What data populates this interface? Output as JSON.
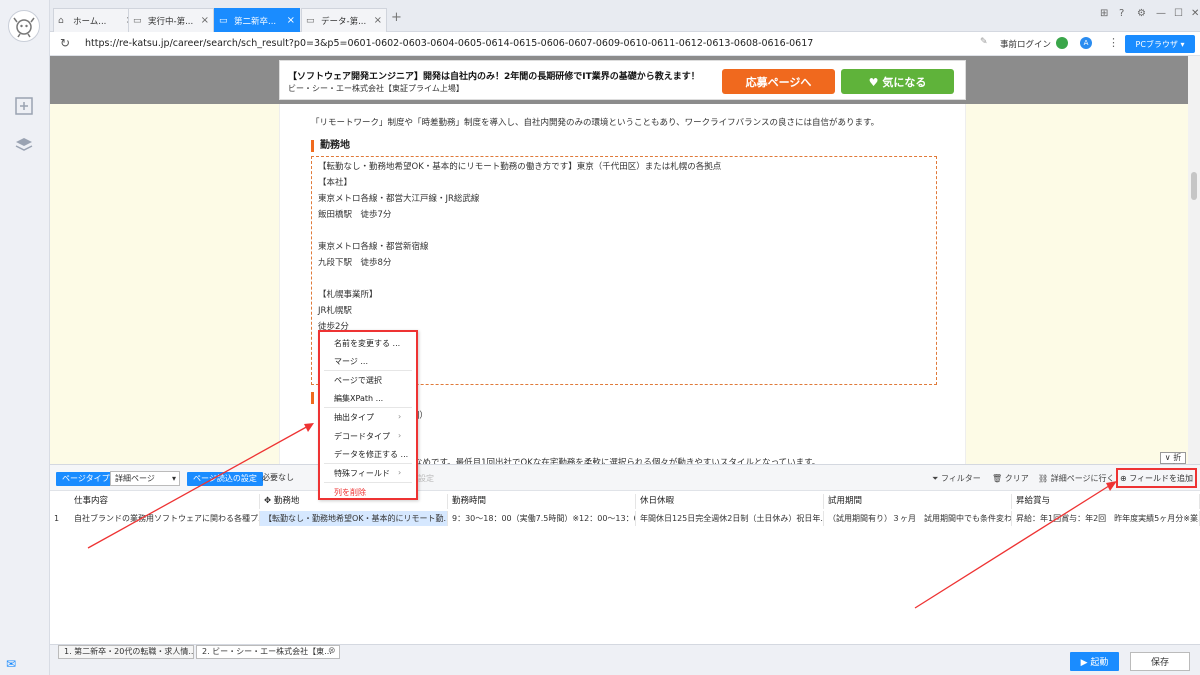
{
  "tabs": [
    {
      "label": "ホーム...",
      "icon": "home-icon"
    },
    {
      "label": "実行中-第...",
      "icon": "page-icon"
    },
    {
      "label": "第二新卒...",
      "icon": "page-icon"
    },
    {
      "label": "データ-第...",
      "icon": "page-icon"
    }
  ],
  "address": {
    "url": "https://re-katsu.jp/career/search/sch_result?p0=3&p5=0601-0602-0603-0604-0605-0614-0615-0606-0607-0609-0610-0611-0612-0613-0608-0616-0617",
    "prelogin": "事前ログイン",
    "browser_button": "PCブラウザ"
  },
  "job": {
    "title": "【ソフトウェア開発エンジニア】開発は自社内のみ！2年間の長期研修でIT業界の基礎から教えます！",
    "company": "ビー・シー・エー株式会社【東証プライム上場】",
    "apply_label": "応募ページへ",
    "fav_label": "♥ 気になる",
    "intro": "「リモートワーク」制度や「時差勤務」制度を導入し、自社内開発のみの環境ということもあり、ワークライフバランスの良さには自信があります。",
    "section_title": "勤務地",
    "location_lines": [
      "【転勤なし・勤務地希望OK・基本的にリモート勤務の働き方です】東京（千代田区）または札幌の各拠点",
      "【本社】",
      "東京メトロ各線・都営大江戸線・JR総武線",
      "飯田橋駅　徒歩7分",
      "",
      "東京メトロ各線・都営新宿線",
      "九段下駅　徒歩8分",
      "",
      "【札幌事業所】",
      "JR札幌駅",
      "徒歩2分"
    ],
    "partial_1": "5時間）",
    "partial_2": "休憩",
    "partial_3": "と少なめです。最低月1回出社でOKな在宅勤務を柔軟に選択られる個々が動きやすいスタイルとなっています。",
    "fold_label": "折る"
  },
  "context_menu": {
    "items": [
      {
        "label": "名前を変更する ..."
      },
      {
        "label": "マージ ..."
      },
      {
        "label": "ページで選択"
      },
      {
        "label": "編集XPath ..."
      },
      {
        "label": "抽出タイプ",
        "submenu": true
      },
      {
        "label": "デコードタイプ",
        "submenu": true
      },
      {
        "label": "データを修正する ..."
      },
      {
        "label": "特殊フィールド",
        "submenu": true
      },
      {
        "label": "列を削除",
        "danger": true
      }
    ]
  },
  "toolbar": {
    "page_type_tag": "ページタイプ",
    "page_type_value": "詳細ページ",
    "page_settings_tag": "ページ読込の設定",
    "required_value": "必要なし",
    "settings_hint": "設定",
    "filter": "フィルター",
    "clear": "クリア",
    "goto_detail": "詳細ページに行く",
    "add_field": "フィールドを追加"
  },
  "grid": {
    "columns": [
      "仕事内容",
      "勤務地",
      "勤務時間",
      "休日休暇",
      "試用期間",
      "昇給賞与"
    ],
    "rows": [
      {
        "num": "1",
        "cells": [
          "自社ブランドの業務用ソフトウェアに関わる各種プ...",
          "【転勤なし・勤務地希望OK・基本的にリモート勤...",
          "9：30～18：00（実働7.5時間）※12：00～13：00...",
          "年間休日125日完全週休2日制（土日休み）祝日年...",
          "（試用期間有り）３ヶ月　試用期間中でも条件変わ...",
          "昇給：年1回賞与：年2回　昨年度実績5ヶ月分※業..."
        ]
      }
    ]
  },
  "bottom": {
    "tabs": [
      "1. 第二新卒・20代の転職・求人情...",
      "2. ビー・シー・エー株式会社【東..."
    ],
    "run_label": "▶ 起動",
    "save_label": "保存"
  }
}
